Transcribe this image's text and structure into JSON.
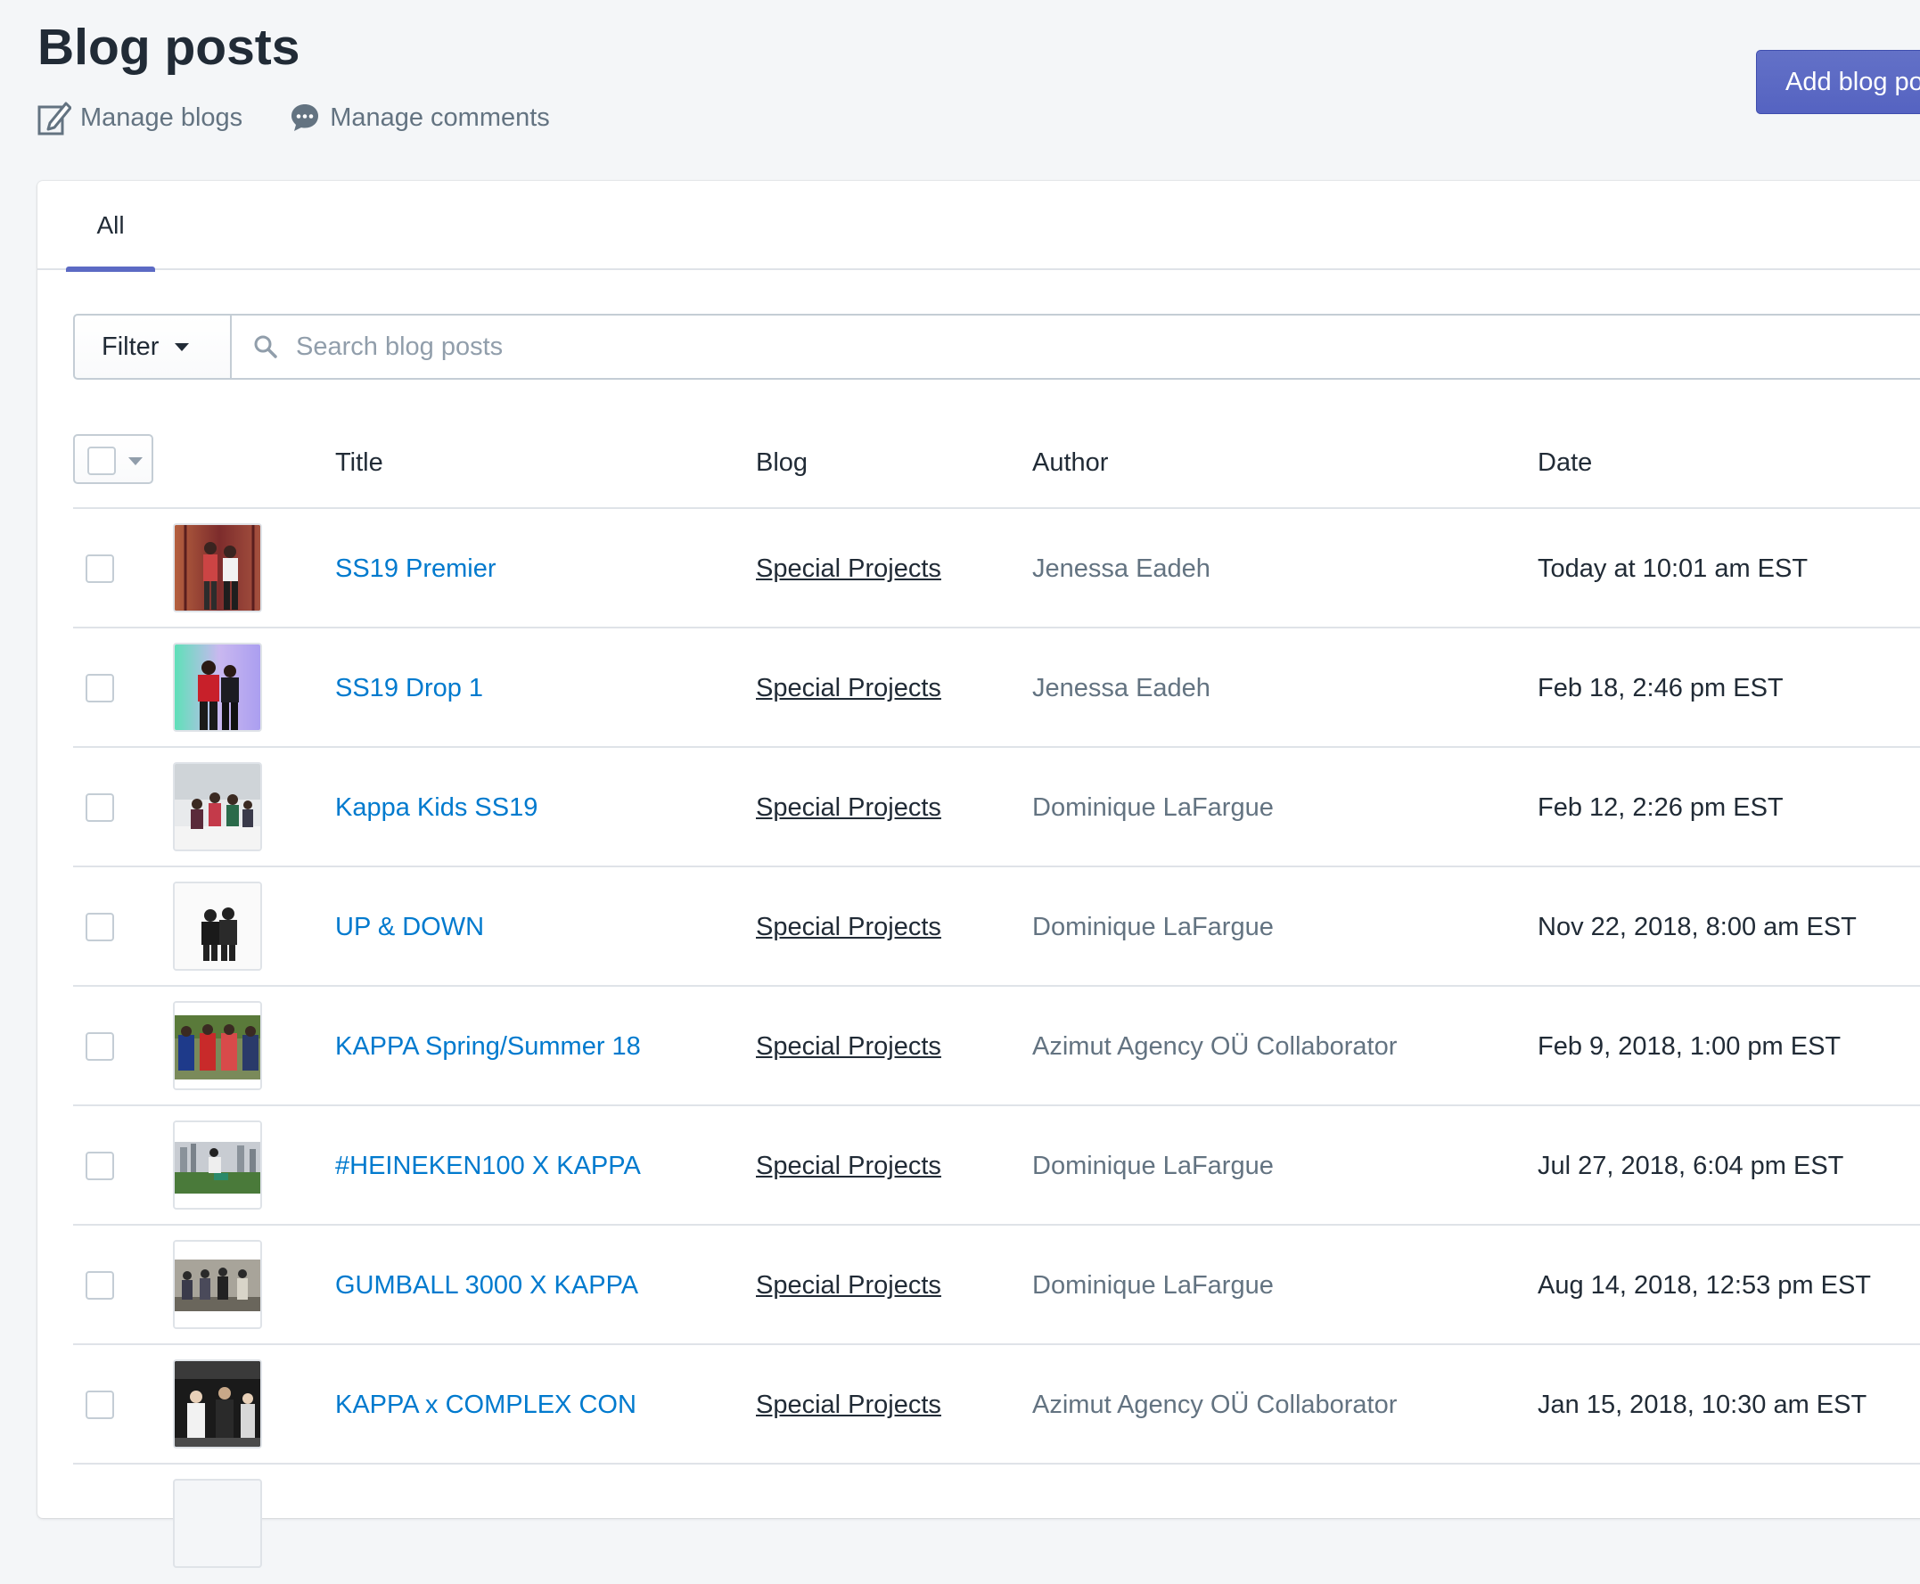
{
  "header": {
    "title": "Blog posts",
    "primary_action": "Add blog post",
    "secondary_actions": [
      {
        "label": "Manage blogs",
        "icon": "edit-icon"
      },
      {
        "label": "Manage comments",
        "icon": "comment-icon"
      }
    ]
  },
  "tabs": [
    {
      "label": "All",
      "selected": true
    }
  ],
  "filter": {
    "button_label": "Filter",
    "search_placeholder": "Search blog posts"
  },
  "table": {
    "columns": [
      "Title",
      "Blog",
      "Author",
      "Date"
    ],
    "rows": [
      {
        "title": "SS19 Premier",
        "blog": "Special Projects",
        "author": "Jenessa Eadeh",
        "date": "Today at 10:01 am EST"
      },
      {
        "title": "SS19 Drop 1",
        "blog": "Special Projects",
        "author": "Jenessa Eadeh",
        "date": "Feb 18, 2:46 pm EST"
      },
      {
        "title": "Kappa Kids SS19",
        "blog": "Special Projects",
        "author": "Dominique LaFargue",
        "date": "Feb 12, 2:26 pm EST"
      },
      {
        "title": "UP & DOWN",
        "blog": "Special Projects",
        "author": "Dominique LaFargue",
        "date": "Nov 22, 2018, 8:00 am EST"
      },
      {
        "title": "KAPPA Spring/Summer 18",
        "blog": "Special Projects",
        "author": "Azimut Agency OÜ Collaborator",
        "date": "Feb 9, 2018, 1:00 pm EST"
      },
      {
        "title": "#HEINEKEN100 X KAPPA",
        "blog": "Special Projects",
        "author": "Dominique LaFargue",
        "date": "Jul 27, 2018, 6:04 pm EST"
      },
      {
        "title": "GUMBALL 3000 X KAPPA",
        "blog": "Special Projects",
        "author": "Dominique LaFargue",
        "date": "Aug 14, 2018, 12:53 pm EST"
      },
      {
        "title": "KAPPA x COMPLEX CON",
        "blog": "Special Projects",
        "author": "Azimut Agency OÜ Collaborator",
        "date": "Jan 15, 2018, 10:30 am EST"
      }
    ]
  },
  "colors": {
    "accent": "#5c6ac4",
    "link": "#007ace",
    "background": "#f4f6f8",
    "muted_text": "#637381"
  }
}
